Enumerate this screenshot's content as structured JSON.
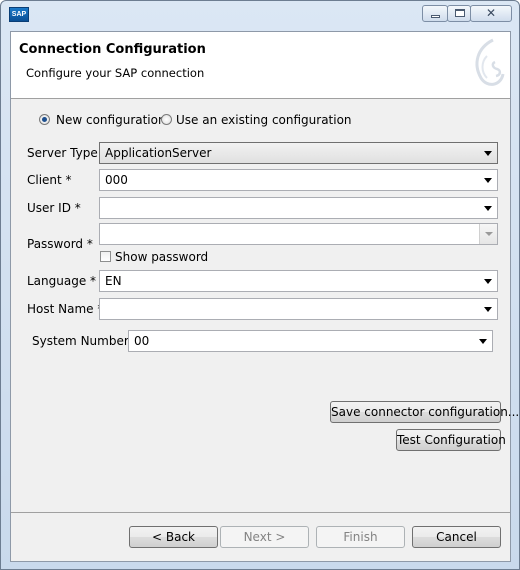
{
  "window": {
    "app_icon_text": "SAP",
    "close_glyph": "✕"
  },
  "header": {
    "title": "Connection Configuration",
    "subtitle": "Configure your SAP connection"
  },
  "config_mode": {
    "new_label": "New configuration",
    "existing_label": "Use an existing configuration",
    "selected": "new"
  },
  "form": {
    "server_type": {
      "label": "Server Type",
      "value": "ApplicationServer"
    },
    "client": {
      "label": "Client *",
      "value": "000"
    },
    "user_id": {
      "label": "User ID *",
      "value": ""
    },
    "password": {
      "label": "Password *",
      "value": ""
    },
    "show_password": {
      "label": "Show password",
      "checked": false
    },
    "language": {
      "label": "Language *",
      "value": "EN"
    },
    "host_name": {
      "label": "Host Name *",
      "value": ""
    },
    "system_number": {
      "label": "System Number *",
      "value": "00"
    }
  },
  "actions": {
    "save_connector": "Save connector configuration...",
    "test_configuration": "Test Configuration"
  },
  "wizard": {
    "back": "< Back",
    "next": "Next >",
    "finish": "Finish",
    "cancel": "Cancel"
  }
}
